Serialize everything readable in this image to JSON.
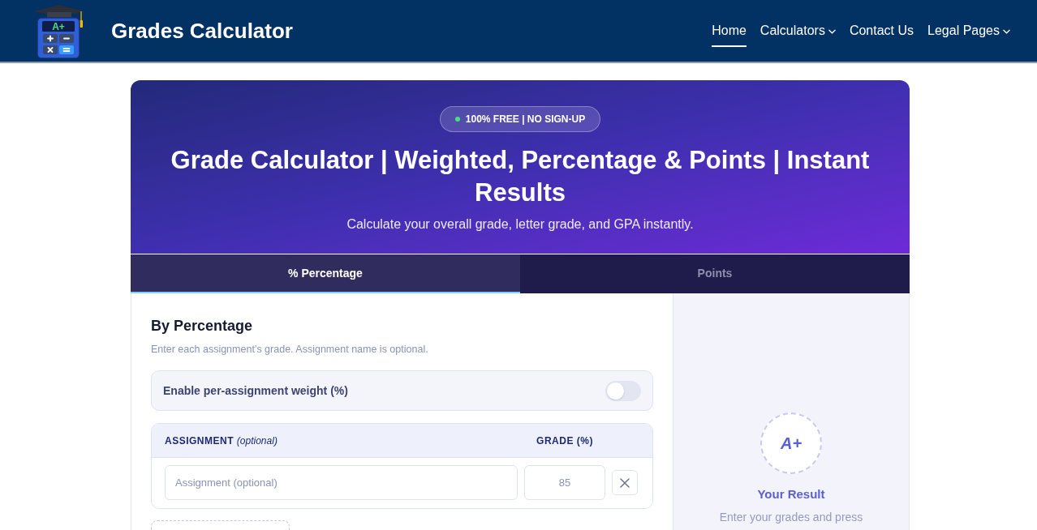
{
  "header": {
    "logo": {
      "screen_text": "A+"
    },
    "site_title": "Grades Calculator",
    "nav": [
      {
        "label": "Home",
        "selected": true,
        "dropdown": false
      },
      {
        "label": "Calculators",
        "selected": false,
        "dropdown": true
      },
      {
        "label": "Contact Us",
        "selected": false,
        "dropdown": false
      },
      {
        "label": "Legal Pages",
        "selected": false,
        "dropdown": true
      }
    ]
  },
  "hero": {
    "badge": "100% FREE | NO SIGN-UP",
    "title": "Grade Calculator | Weighted, Percentage & Points | Instant Results",
    "subtitle": "Calculate your overall grade, letter grade, and GPA instantly."
  },
  "tabs": [
    {
      "label": "% Percentage",
      "selected": true
    },
    {
      "label": "Points",
      "selected": false
    }
  ],
  "form": {
    "heading": "By Percentage",
    "hint": "Enter each assignment’s grade. Assignment name is optional.",
    "weight_toggle": {
      "label": "Enable per-assignment weight (%)",
      "on": false
    },
    "table": {
      "columns": [
        {
          "label": "ASSIGNMENT *(optional)*"
        },
        {
          "label": "GRADE (%)"
        }
      ],
      "rows": [
        {
          "assignment": {
            "placeholder": "Assignment (optional)"
          },
          "grade": {
            "placeholder": "85"
          }
        }
      ]
    }
  },
  "result": {
    "grade": "A+",
    "title": "Your Result",
    "text": "Enter your grades and press"
  }
}
